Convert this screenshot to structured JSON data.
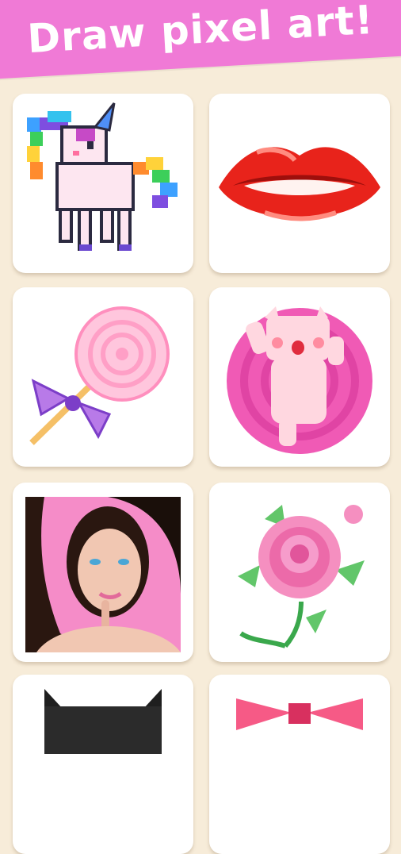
{
  "header": {
    "title": "Draw pixel art!",
    "color": "#f07ad6"
  },
  "gallery": [
    {
      "icon": "unicorn-icon"
    },
    {
      "icon": "lips-icon"
    },
    {
      "icon": "lollipop-icon"
    },
    {
      "icon": "pink-cat-icon"
    },
    {
      "icon": "woman-portrait-image"
    },
    {
      "icon": "pink-rose-icon"
    },
    {
      "icon": "cat-icon"
    },
    {
      "icon": "pink-bow-icon"
    }
  ]
}
